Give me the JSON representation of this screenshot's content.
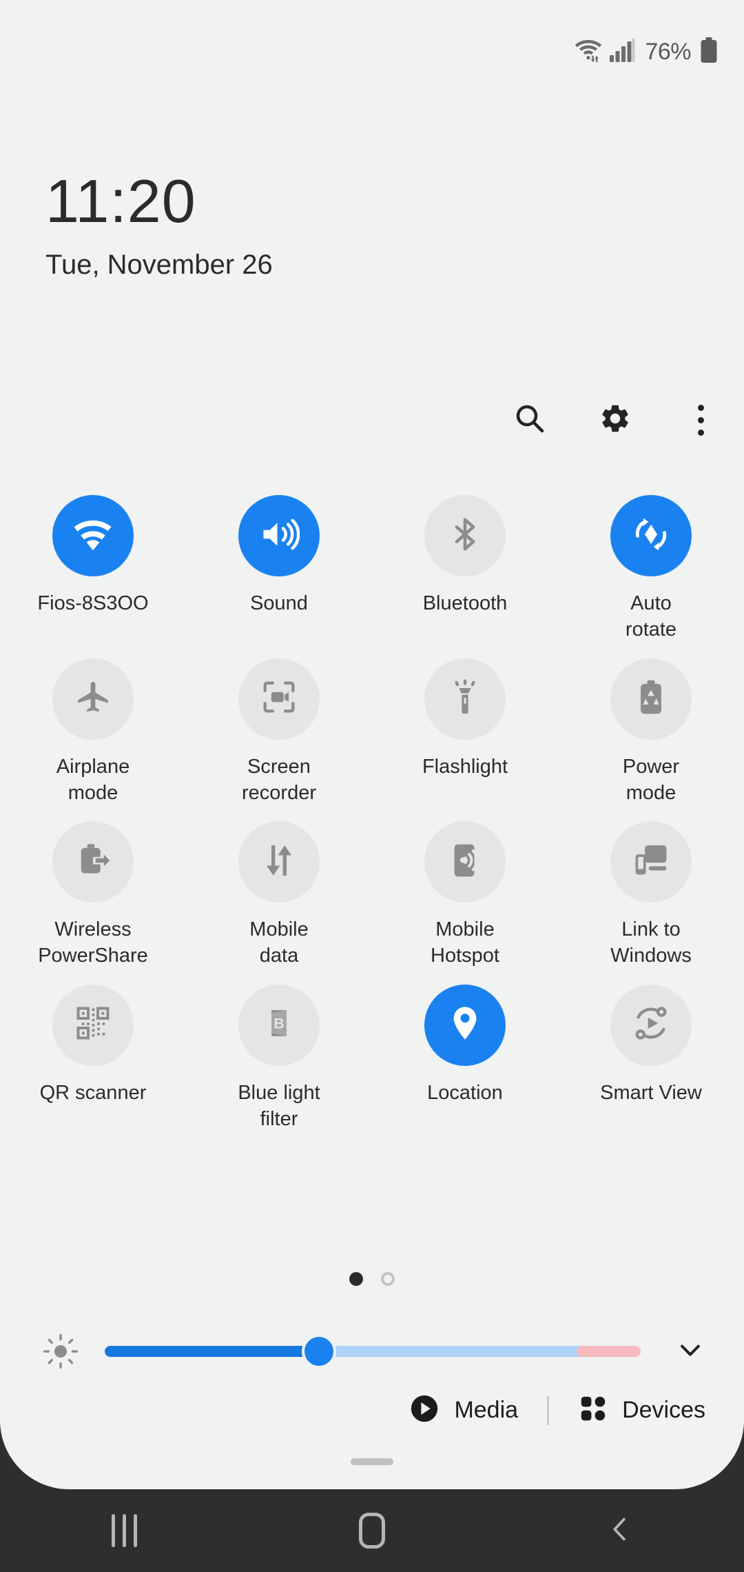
{
  "statusbar": {
    "wifi_icon": "wifi-data-arrows-icon",
    "signal_icon": "cellular-signal-icon",
    "battery_percent": "76%",
    "battery_icon": "battery-icon"
  },
  "clock": {
    "time": "11:20",
    "date": "Tue, November 26"
  },
  "toolbar": {
    "search_icon": "search-icon",
    "settings_icon": "gear-icon",
    "more_icon": "more-vertical-icon"
  },
  "tiles": [
    {
      "label": "Fios-8S3OO",
      "icon": "wifi-icon",
      "active": true
    },
    {
      "label": "Sound",
      "icon": "sound-icon",
      "active": true
    },
    {
      "label": "Bluetooth",
      "icon": "bluetooth-icon",
      "active": false
    },
    {
      "label": "Auto\nrotate",
      "icon": "auto-rotate-icon",
      "active": true
    },
    {
      "label": "Airplane\nmode",
      "icon": "airplane-icon",
      "active": false
    },
    {
      "label": "Screen\nrecorder",
      "icon": "screen-recorder-icon",
      "active": false
    },
    {
      "label": "Flashlight",
      "icon": "flashlight-icon",
      "active": false
    },
    {
      "label": "Power\nmode",
      "icon": "power-mode-icon",
      "active": false
    },
    {
      "label": "Wireless\nPowerShare",
      "icon": "wireless-powershare-icon",
      "active": false
    },
    {
      "label": "Mobile\ndata",
      "icon": "mobile-data-icon",
      "active": false
    },
    {
      "label": "Mobile\nHotspot",
      "icon": "mobile-hotspot-icon",
      "active": false
    },
    {
      "label": "Link to\nWindows",
      "icon": "link-to-windows-icon",
      "active": false
    },
    {
      "label": "QR scanner",
      "icon": "qr-scanner-icon",
      "active": false
    },
    {
      "label": "Blue light\nfilter",
      "icon": "blue-light-filter-icon",
      "active": false
    },
    {
      "label": "Location",
      "icon": "location-pin-icon",
      "active": true
    },
    {
      "label": "Smart View",
      "icon": "smart-view-icon",
      "active": false
    }
  ],
  "pager": {
    "total_pages": 2,
    "current_page": 1
  },
  "brightness": {
    "sun_icon": "brightness-sun-icon",
    "value_percent": 40,
    "warm_zone_start_percent": 88,
    "expand_icon": "chevron-down-icon"
  },
  "footer": {
    "media_label": "Media",
    "media_icon": "play-circle-icon",
    "devices_label": "Devices",
    "devices_icon": "grid-dots-icon"
  },
  "drag_handle": "panel-drag-handle",
  "navbar": {
    "recents_icon": "recents-icon",
    "home_icon": "home-icon",
    "back_icon": "back-chevron-icon"
  },
  "colors": {
    "accent_blue": "#1a82f0",
    "panel_bg": "#f1f2f2",
    "tile_inactive": "#e4e5e6",
    "icon_gray": "#8a8c8e",
    "navbar_bg": "#2e2e2e",
    "warm_pink": "#f7b9be"
  }
}
